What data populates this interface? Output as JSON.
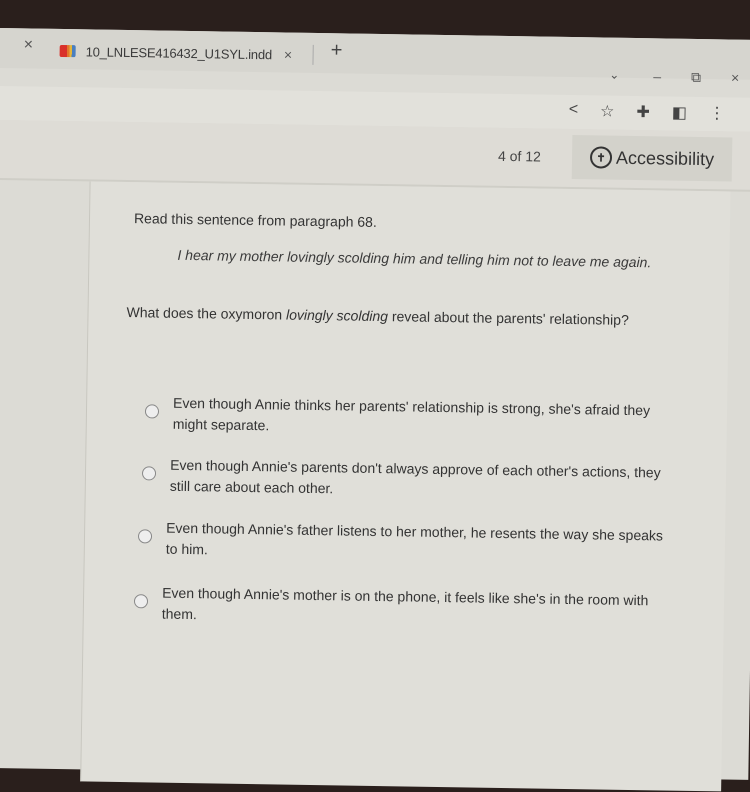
{
  "browser": {
    "close_left": "×",
    "tab_title": "10_LNLESE416432_U1SYL.indd",
    "tab_close": "×",
    "new_tab": "+",
    "tab_search": "⌄",
    "minimize": "–",
    "restore": "⧉",
    "close": "×",
    "toolbar_icons": {
      "share": "<",
      "bookmark": "☆",
      "extensions": "✚",
      "side_panel": "◧",
      "menu": "⋮"
    }
  },
  "header": {
    "counter": "4 of 12",
    "accessibility_label": "Accessibility",
    "accessibility_icon": "✝"
  },
  "question": {
    "prompt": "Read this sentence from paragraph 68.",
    "quote": "I hear my mother lovingly scolding him and telling him not to leave me again.",
    "stem_before": "What does the oxymoron ",
    "stem_emphasis": "lovingly scolding",
    "stem_after": " reveal about the parents' relationship?",
    "options": [
      {
        "text": "Even though Annie thinks her parents' relationship is strong, she's afraid they might separate.",
        "selected": false
      },
      {
        "text": "Even though Annie's parents don't always approve of each other's actions, they still care about each other.",
        "selected": false
      },
      {
        "text": "Even though Annie's father listens to her mother, he resents the way she speaks to him.",
        "selected": false
      },
      {
        "text": "Even though Annie's mother is on the phone, it feels like she's in the room with them.",
        "selected": false
      }
    ]
  }
}
